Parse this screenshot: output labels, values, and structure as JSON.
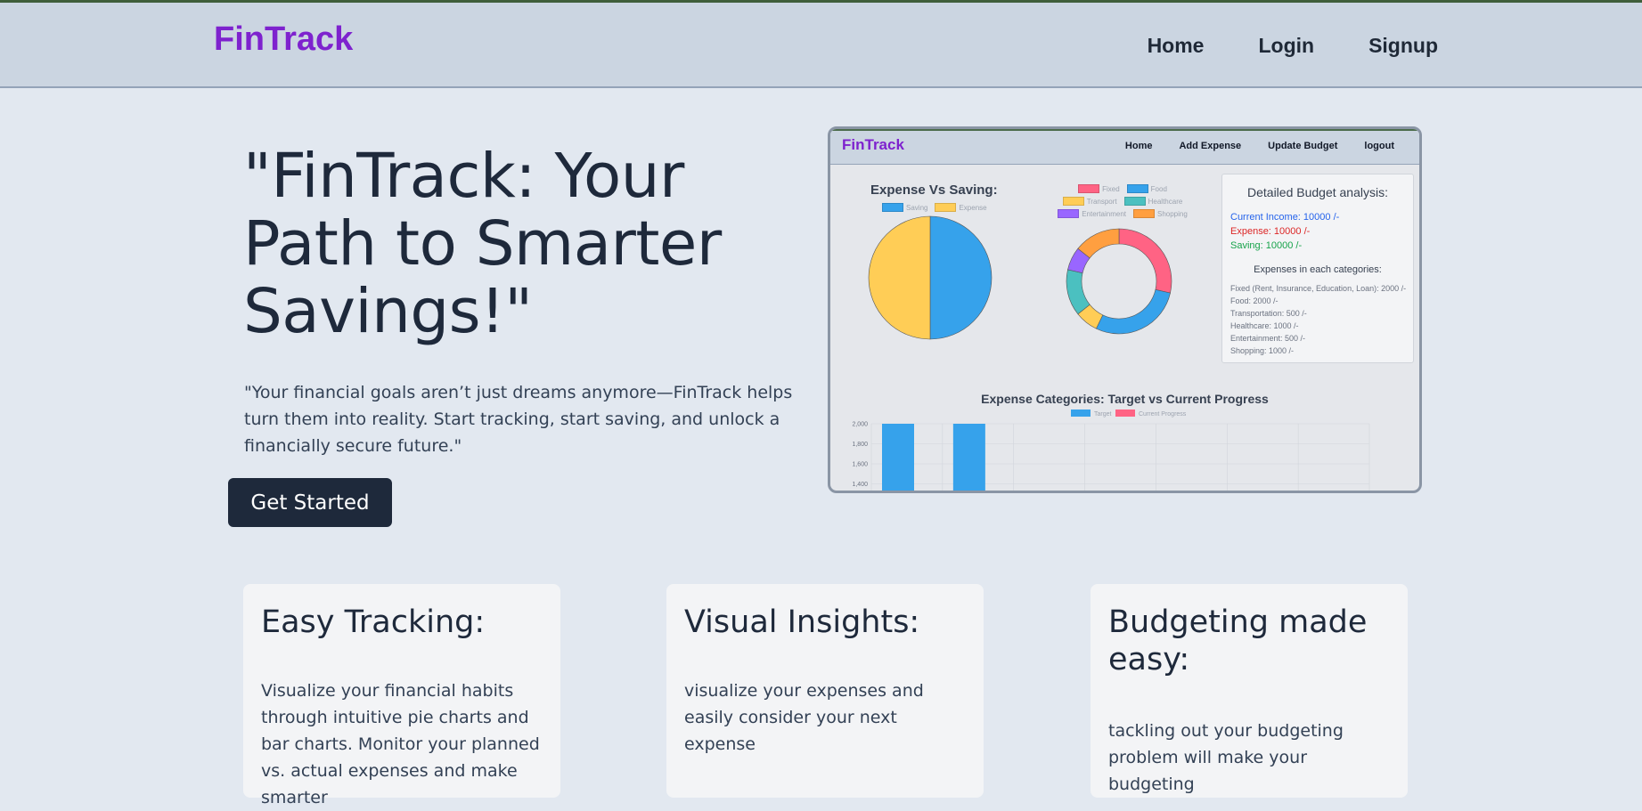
{
  "navbar": {
    "brand": "FinTrack",
    "links": [
      "Home",
      "Login",
      "Signup"
    ]
  },
  "hero": {
    "title": "\"FinTrack: Your Path to Smarter Savings!\"",
    "subtitle": "\"Your financial goals aren’t just dreams anymore—FinTrack helps turn them into reality. Start tracking, start saving, and unlock a financially secure future.\"",
    "cta_label": "Get Started"
  },
  "preview": {
    "brand": "FinTrack",
    "links": [
      "Home",
      "Add Expense",
      "Update Budget",
      "logout"
    ],
    "pie": {
      "title": "Expense Vs Saving:",
      "legend": [
        "Saving",
        "Expense"
      ],
      "values": [
        10000,
        10000
      ],
      "colors": [
        "#36a2eb",
        "#ffcd56"
      ]
    },
    "doughnut": {
      "legend": [
        "Fixed",
        "Food",
        "Transport",
        "Healthcare",
        "Entertainment",
        "Shopping"
      ],
      "values": [
        2000,
        2000,
        500,
        1000,
        500,
        1000
      ],
      "colors": [
        "#ff6384",
        "#36a2eb",
        "#ffcd56",
        "#4bc0c0",
        "#9966ff",
        "#ff9f40"
      ]
    },
    "analysis": {
      "title": "Detailed Budget analysis:",
      "income": "Current Income: 10000 /-",
      "expense": "Expense: 10000 /-",
      "saving": "Saving: 10000 /-",
      "categories_title": "Expenses in each categories:",
      "categories": [
        "Fixed (Rent, Insurance, Education, Loan): 2000 /-",
        "Food: 2000 /-",
        "Transportation: 500 /-",
        "Healthcare: 1000 /-",
        "Entertainment: 500 /-",
        "Shopping: 1000 /-"
      ],
      "colors": {
        "income": "#2563eb",
        "expense": "#dc2626",
        "saving": "#16a34a"
      }
    },
    "bar": {
      "title": "Expense Categories: Target vs Current Progress",
      "legend": [
        "Target",
        "Current Progress"
      ],
      "colors": [
        "#36a2eb",
        "#ff6384"
      ],
      "y_ticks": [
        "2,000",
        "1,800",
        "1,600",
        "1,400"
      ]
    }
  },
  "features": [
    {
      "title": "Easy Tracking:",
      "text": "Visualize your financial habits through intuitive pie charts and bar charts. Monitor your planned vs. actual expenses and make smarter"
    },
    {
      "title": "Visual Insights:",
      "text": "visualize your expenses and easily consider your next expense"
    },
    {
      "title": "Budgeting made easy:",
      "text": "tackling out your budgeting problem will make your budgeting"
    }
  ]
}
